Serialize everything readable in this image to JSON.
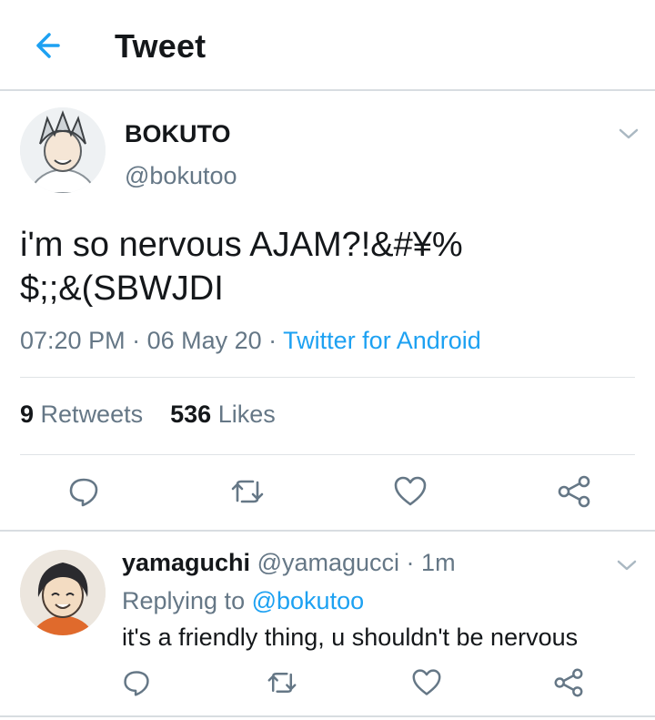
{
  "header": {
    "title": "Tweet"
  },
  "tweet": {
    "display_name": "BOKUTO",
    "handle": "@bokutoo",
    "text_line1": "i'm so nervous AJAM?!&#¥%",
    "text_line2": "$;;&(SBWJDI",
    "time": "07:20 PM",
    "sep1": " · ",
    "date": "06 May 20",
    "sep2": " · ",
    "source": "Twitter for Android",
    "retweets_count": "9",
    "retweets_label": "Retweets",
    "likes_count": "536",
    "likes_label": "Likes"
  },
  "reply": {
    "display_name": "yamaguchi",
    "handle": "@yamagucci",
    "sep": " · ",
    "time_ago": "1m",
    "replying_to_label": "Replying to",
    "replying_to_handle": "@bokutoo",
    "text": "it's a friendly thing, u shouldn't be nervous"
  },
  "icons": {
    "back": "arrow-left-icon",
    "chevron": "chevron-down-icon",
    "reply": "comment-icon",
    "retweet": "retweet-icon",
    "like": "heart-icon",
    "share": "share-icon"
  },
  "colors": {
    "accent": "#1da1f2",
    "secondary_text": "#657786",
    "primary_text": "#14171a",
    "divider": "#dfe3e6"
  }
}
